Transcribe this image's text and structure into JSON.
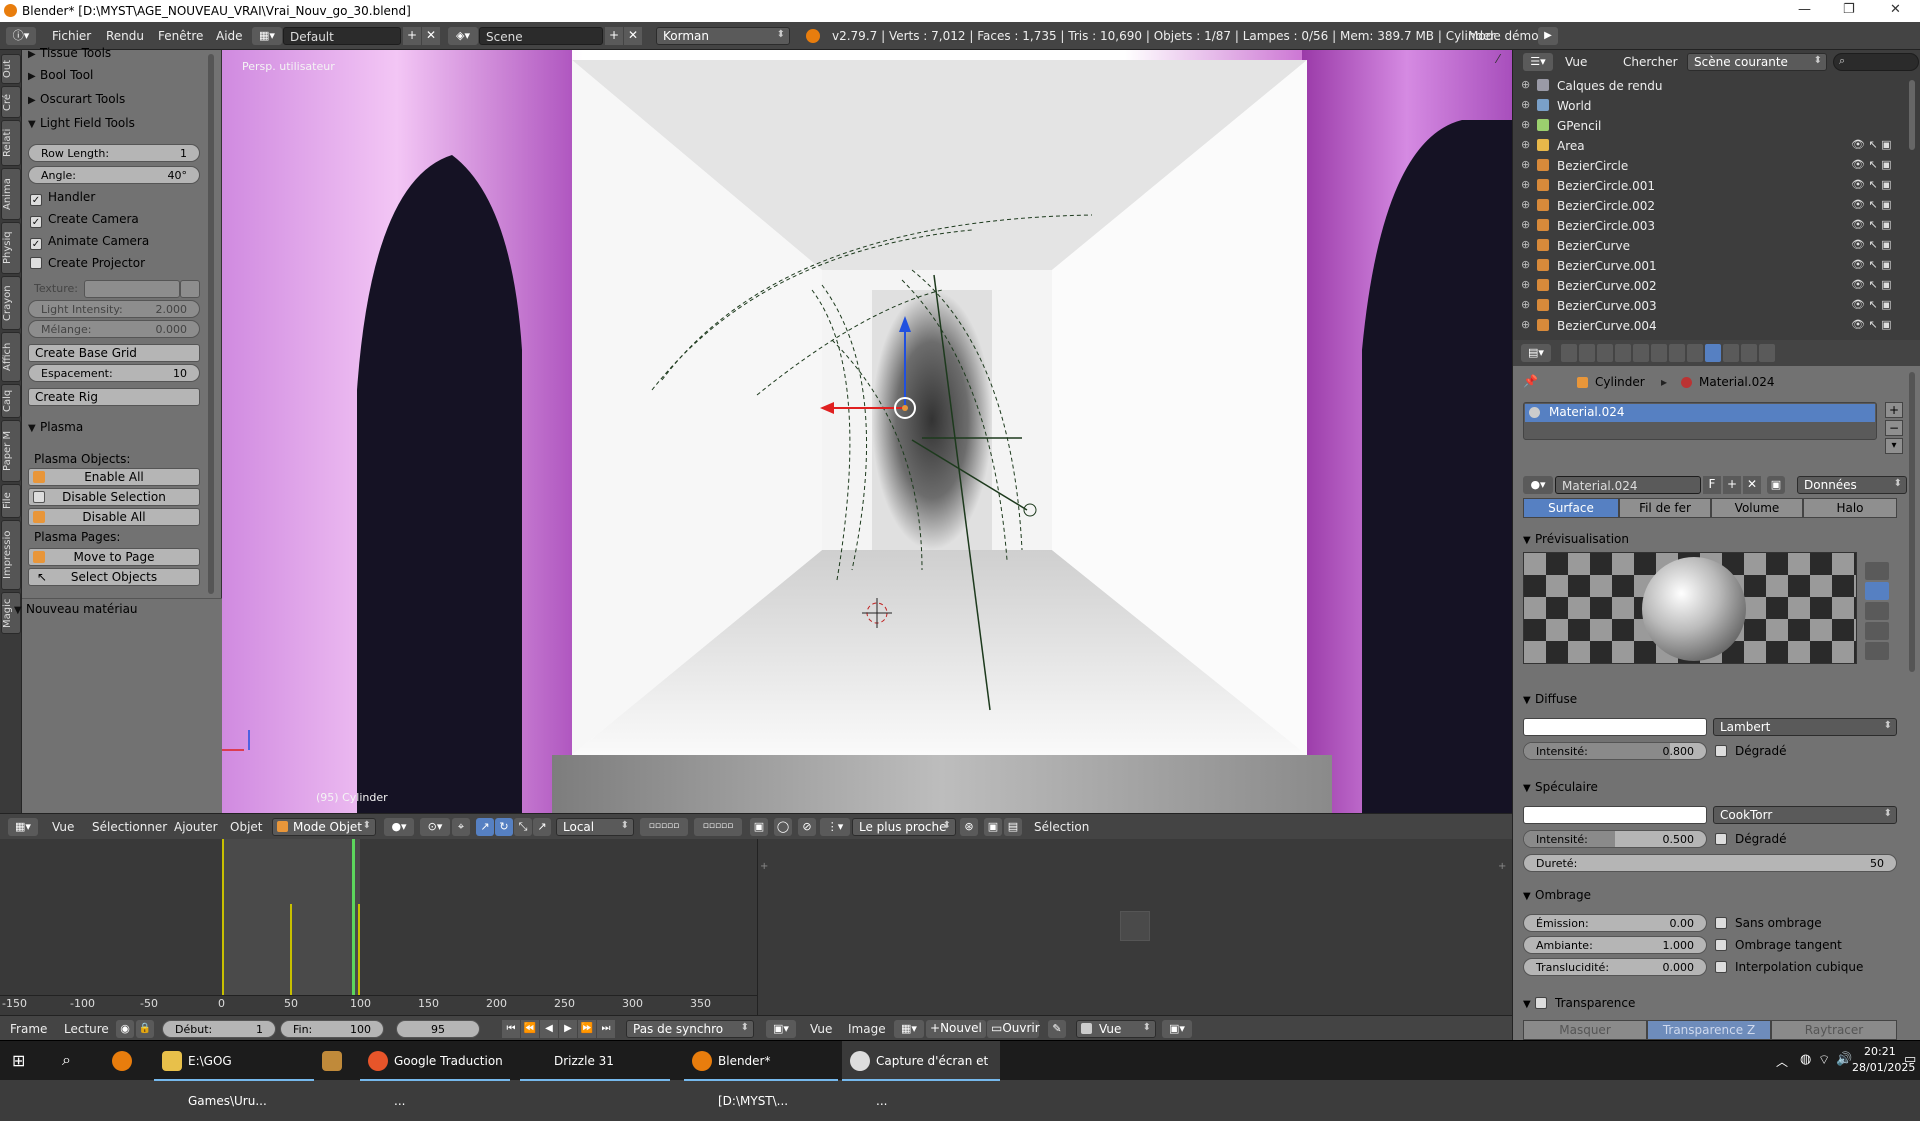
{
  "window": {
    "title": "Blender* [D:\\MYST\\AGE_NOUVEAU_VRAI\\Vrai_Nouv_go_30.blend]"
  },
  "menu": {
    "items": [
      "Fichier",
      "Rendu",
      "Fenêtre",
      "Aide"
    ],
    "layout": "Default",
    "scene": "Scene",
    "engine": "Korman",
    "stats": "v2.79.7 | Verts : 7,012 | Faces : 1,735 | Tris : 10,690 | Objets : 1/87 | Lampes : 0/56 | Mem: 389.7 MB | Cylinder",
    "mode_demo": "Mode démo :"
  },
  "left_tabs": [
    "Out",
    "Cré",
    "Relati",
    "Anima",
    "Physiq",
    "Crayon",
    "Affich",
    "Calq",
    "Paper M",
    "File",
    "Impressio",
    "Magic"
  ],
  "tools": {
    "tissue": "Tissue Tools",
    "bool": "Bool Tool",
    "oscurart": "Oscurart Tools",
    "light_field": "Light Field Tools",
    "row_length_label": "Row Length:",
    "row_length": "1",
    "angle_label": "Angle:",
    "angle": "40°",
    "handler": "Handler",
    "create_camera": "Create Camera",
    "animate_camera": "Animate Camera",
    "create_projector": "Create Projector",
    "texture": "Texture:",
    "light_intensity_label": "Light Intensity:",
    "light_intensity": "2.000",
    "melange_label": "Mélange:",
    "melange": "0.000",
    "create_base_grid": "Create Base Grid",
    "espacement_label": "Espacement:",
    "espacement": "10",
    "create_rig": "Create Rig",
    "plasma": "Plasma",
    "plasma_objects": "Plasma Objects:",
    "enable_all": "Enable All",
    "disable_selection": "Disable Selection",
    "disable_all": "Disable All",
    "plasma_pages": "Plasma Pages:",
    "move_to_page": "Move to Page",
    "select_objects": "Select Objects",
    "nouveau_materiau": "Nouveau matériau"
  },
  "viewport": {
    "persp": "Persp. utilisateur",
    "object_label": "(95) Cylinder"
  },
  "viewport_header": {
    "vue": "Vue",
    "select": "Sélectionner",
    "add": "Ajouter",
    "object": "Objet",
    "mode": "Mode Objet",
    "orientation": "Local",
    "snap": "Le plus proche",
    "selection": "Sélection"
  },
  "timeline": {
    "ticks": [
      "-150",
      "-100",
      "-50",
      "0",
      "50",
      "100",
      "150",
      "200",
      "250",
      "300",
      "350"
    ]
  },
  "timeline_header": {
    "frame": "Frame",
    "playback": "Lecture",
    "start_label": "Début:",
    "start": "1",
    "end_label": "Fin:",
    "end": "100",
    "current": "95",
    "sync": "Pas de synchro",
    "vue": "Vue",
    "image": "Image",
    "new": "Nouvel",
    "open": "Ouvrir",
    "view": "Vue"
  },
  "outliner": {
    "vue": "Vue",
    "search": "Chercher",
    "scope": "Scène courante",
    "rows": [
      {
        "name": "Calques de rendu",
        "color": "#9a9aa6"
      },
      {
        "name": "World",
        "color": "#7aa0c8"
      },
      {
        "name": "GPencil",
        "color": "#9bd06e"
      },
      {
        "name": "Area",
        "color": "#e8b84a"
      },
      {
        "name": "BezierCircle",
        "color": "#d88a3a"
      },
      {
        "name": "BezierCircle.001",
        "color": "#d88a3a"
      },
      {
        "name": "BezierCircle.002",
        "color": "#d88a3a"
      },
      {
        "name": "BezierCircle.003",
        "color": "#d88a3a"
      },
      {
        "name": "BezierCurve",
        "color": "#d88a3a"
      },
      {
        "name": "BezierCurve.001",
        "color": "#d88a3a"
      },
      {
        "name": "BezierCurve.002",
        "color": "#d88a3a"
      },
      {
        "name": "BezierCurve.003",
        "color": "#d88a3a"
      },
      {
        "name": "BezierCurve.004",
        "color": "#d88a3a"
      }
    ]
  },
  "properties": {
    "breadcrumb_object": "Cylinder",
    "breadcrumb_material": "Material.024",
    "slot": "Material.024",
    "material_name": "Material.024",
    "f": "F",
    "data": "Données",
    "tabs": [
      "Surface",
      "Fil de fer",
      "Volume",
      "Halo"
    ],
    "preview": "Prévisualisation",
    "diffuse": "Diffuse",
    "diffuse_shader": "Lambert",
    "intensity_label": "Intensité:",
    "diffuse_intensity": "0.800",
    "ramp": "Dégradé",
    "specular": "Spéculaire",
    "specular_shader": "CookTorr",
    "specular_intensity": "0.500",
    "hardness_label": "Dureté:",
    "hardness": "50",
    "shading": "Ombrage",
    "emission_label": "Émission:",
    "emission": "0.00",
    "ambient_label": "Ambiante:",
    "ambient": "1.000",
    "translucency_label": "Translucidité:",
    "translucency": "0.000",
    "shadeless": "Sans ombrage",
    "tangent": "Ombrage tangent",
    "cubic": "Interpolation cubique",
    "transparency": "Transparence",
    "mask": "Masquer",
    "ztransp": "Transparence Z",
    "raytrace": "Raytracer"
  },
  "taskbar": {
    "items": [
      "E:\\GOG Games\\Uru...",
      "Google Traduction ...",
      "Drizzle 31",
      "Blender* [D:\\MYST\\...",
      "Capture d'écran et ..."
    ],
    "time": "20:21",
    "date": "28/01/2025"
  }
}
